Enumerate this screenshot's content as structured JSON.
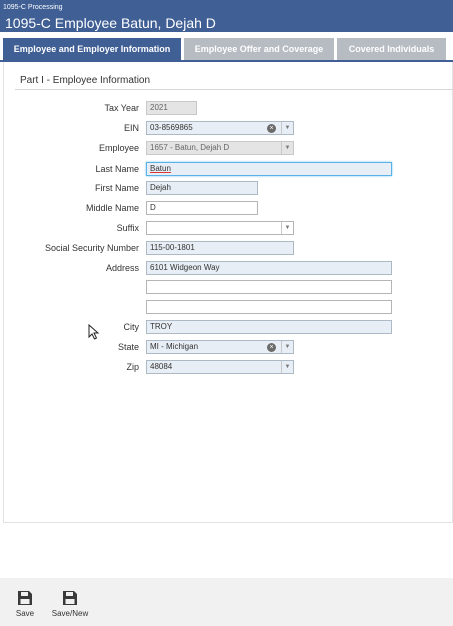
{
  "header": {
    "subtitle": "1095-C Processing",
    "title": "1095-C Employee Batun, Dejah D"
  },
  "tabs": [
    {
      "label": "Employee and Employer Information"
    },
    {
      "label": "Employee Offer and Coverage"
    },
    {
      "label": "Covered Individuals"
    }
  ],
  "section": {
    "title": "Part I - Employee Information"
  },
  "form": {
    "tax_year": {
      "label": "Tax Year",
      "value": "2021"
    },
    "ein": {
      "label": "EIN",
      "value": "03-8569865"
    },
    "employee": {
      "label": "Employee",
      "value": "1657 - Batun, Dejah D"
    },
    "last_name": {
      "label": "Last Name",
      "value": "Batun"
    },
    "first_name": {
      "label": "First Name",
      "value": "Dejah"
    },
    "middle_name": {
      "label": "Middle Name",
      "value": "D"
    },
    "suffix": {
      "label": "Suffix",
      "value": ""
    },
    "ssn": {
      "label": "Social Security Number",
      "value": "115-00-1801"
    },
    "address": {
      "label": "Address",
      "line1": "6101 Widgeon Way",
      "line2": "",
      "line3": ""
    },
    "city": {
      "label": "City",
      "value": "TROY"
    },
    "state": {
      "label": "State",
      "value": "MI - Michigan"
    },
    "zip": {
      "label": "Zip",
      "value": "48084"
    }
  },
  "toolbar": {
    "save_label": "Save",
    "save_new_label": "Save/New"
  },
  "icons": {
    "clear": "clear-icon",
    "dropdown": "chevron-down-icon",
    "save": "floppy-disk-icon",
    "cursor": "mouse-pointer-icon"
  },
  "colors": {
    "header_bg": "#3f5f95",
    "tab_inactive": "#b7bcc3",
    "field_bg": "#e8eef5",
    "focus_border": "#5ab3e8"
  }
}
